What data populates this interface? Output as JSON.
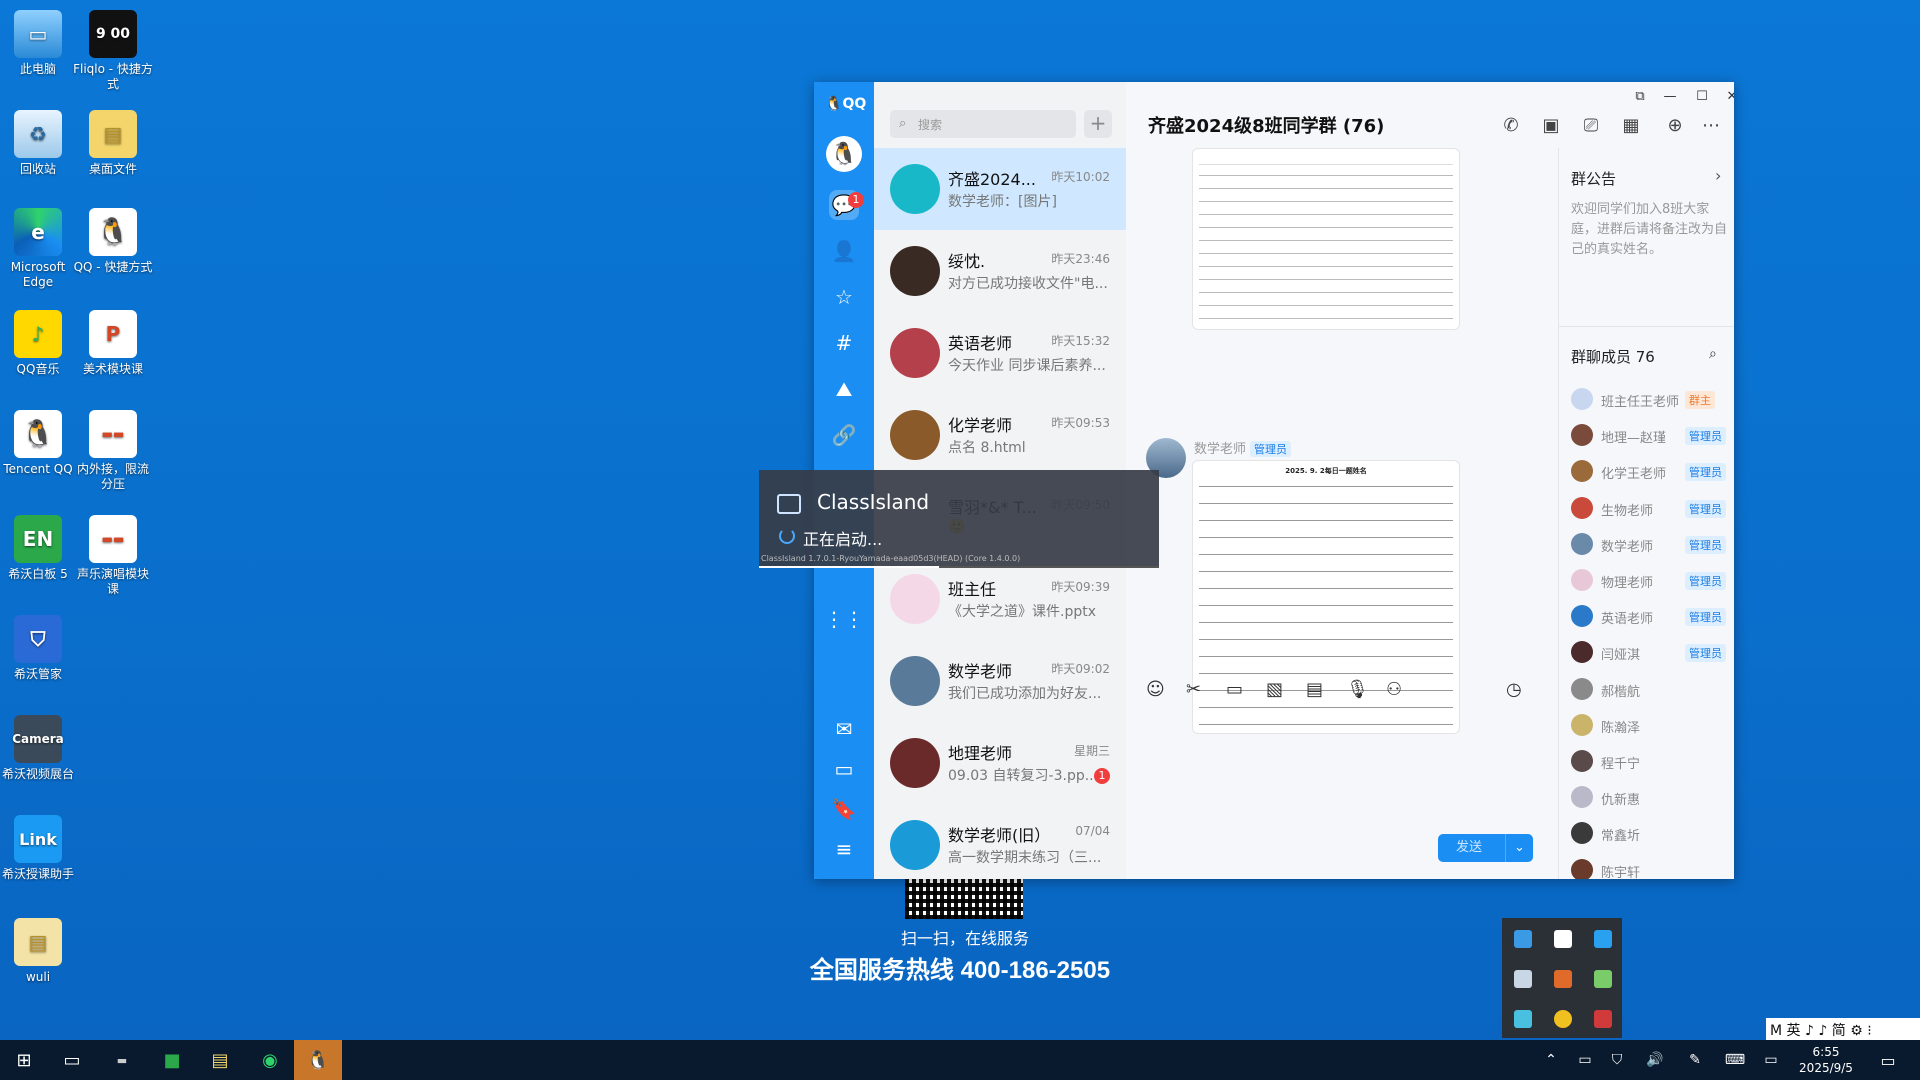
{
  "desktop": {
    "icons": [
      {
        "label": "此电脑",
        "icon": "computer-icon"
      },
      {
        "label": "Fliqlo - 快捷方式",
        "icon": "clock-screensaver-icon",
        "text": "9 00"
      },
      {
        "label": "回收站",
        "icon": "recycle-bin-icon"
      },
      {
        "label": "桌面文件",
        "icon": "folder-icon"
      },
      {
        "label": "Microsoft Edge",
        "icon": "edge-icon"
      },
      {
        "label": "QQ - 快捷方式",
        "icon": "qq-penguin-icon"
      },
      {
        "label": "QQ音乐",
        "icon": "qq-music-icon"
      },
      {
        "label": "美术模块课",
        "icon": "powerpoint-icon"
      },
      {
        "label": "Tencent QQ",
        "icon": "qq-penguin-icon"
      },
      {
        "label": "内外接，限流分压",
        "icon": "slide-file-icon"
      },
      {
        "label": "希沃白板 5",
        "icon": "seewo-whiteboard-icon",
        "text": "EN"
      },
      {
        "label": "声乐演唱模块课",
        "icon": "slide-file-icon"
      },
      {
        "label": "希沃管家",
        "icon": "seewo-shield-icon"
      },
      {
        "label": "希沃视频展台",
        "icon": "camera-icon",
        "text": "Camera"
      },
      {
        "label": "希沃授课助手",
        "icon": "link-icon",
        "text": "Link"
      },
      {
        "label": "wuli",
        "icon": "folder-icon"
      }
    ],
    "scan_text": "扫一扫，在线服务",
    "hotline": "全国服务热线 400-186-2505"
  },
  "qq": {
    "logo": "QQ",
    "nav_badge": "1",
    "search_placeholder": "搜索",
    "conversations": [
      {
        "name": "齐盛2024...",
        "time": "昨天10:02",
        "msg": "数学老师：[图片]",
        "color": "#19b8c9"
      },
      {
        "name": "绥忱.",
        "time": "昨天23:46",
        "msg": "对方已成功接收文件\"电...",
        "color": "#3a2a24"
      },
      {
        "name": "英语老师",
        "time": "昨天15:32",
        "msg": "今天作业 同步课后素养...",
        "color": "#b3404a"
      },
      {
        "name": "化学老师",
        "time": "昨天09:53",
        "msg": "点名 8.html",
        "color": "#8a5a2a"
      },
      {
        "name": "雪羽*&* T...",
        "time": "昨天09:50",
        "msg": "🙂",
        "color": "#f3f3f3"
      },
      {
        "name": "班主任",
        "time": "昨天09:39",
        "msg": "《大学之道》课件.pptx",
        "color": "#f5d8e8"
      },
      {
        "name": "数学老师",
        "time": "昨天09:02",
        "msg": "我们已成功添加为好友...",
        "color": "#5a7a99"
      },
      {
        "name": "地理老师",
        "time": "星期三",
        "msg": "09.03 自转复习-3.pp...",
        "color": "#6a2a2a",
        "badge": "1"
      },
      {
        "name": "数学老师(旧）",
        "time": "07/04",
        "msg": "高一数学期末练习（三...",
        "color": "#1a9ad6"
      }
    ],
    "chat_title": "齐盛2024级8班同学群 (76)",
    "sender": "数学老师",
    "sender_role": "管理员",
    "doc_header": "2025. 9. 2每日一题姓名",
    "send_label": "发送",
    "announcement_title": "群公告",
    "announcement_text": "欢迎同学们加入8班大家庭，进群后请将备注改为自己的真实姓名。",
    "members_title": "群聊成员 76",
    "members": [
      {
        "name": "班主任王老师",
        "role": "群主",
        "color": "#c9d6ef"
      },
      {
        "name": "地理—赵瑾",
        "role": "管理员",
        "color": "#7a4a3a"
      },
      {
        "name": "化学王老师",
        "role": "管理员",
        "color": "#9a6a3a"
      },
      {
        "name": "生物老师",
        "role": "管理员",
        "color": "#c94a3a"
      },
      {
        "name": "数学老师",
        "role": "管理员",
        "color": "#6a8aaa"
      },
      {
        "name": "物理老师",
        "role": "管理员",
        "color": "#e8c8d8"
      },
      {
        "name": "英语老师",
        "role": "管理员",
        "color": "#2a7ac9"
      },
      {
        "name": "闫娅淇",
        "role": "管理员",
        "color": "#4a2a2a"
      },
      {
        "name": "郝楷航",
        "role": "",
        "color": "#8a8a8a"
      },
      {
        "name": "陈瀚泽",
        "role": "",
        "color": "#c9b46a"
      },
      {
        "name": "程千宁",
        "role": "",
        "color": "#5a4a4a"
      },
      {
        "name": "仇新惠",
        "role": "",
        "color": "#b9b9c9"
      },
      {
        "name": "常鑫圻",
        "role": "",
        "color": "#3a3a3a"
      },
      {
        "name": "陈宇轩",
        "role": "",
        "color": "#6a3a2a"
      }
    ]
  },
  "classisland": {
    "title": "ClassIsland",
    "status": "正在启动...",
    "version": "ClassIsland 1.7.0.1-RyouYamada-eaad05d3(HEAD) (Core 1.4.0.0)"
  },
  "ime": "M 英 ♪ ♪ 简 ⚙ ⁝",
  "taskbar": {
    "time": "6:55",
    "date": "2025/9/5"
  }
}
